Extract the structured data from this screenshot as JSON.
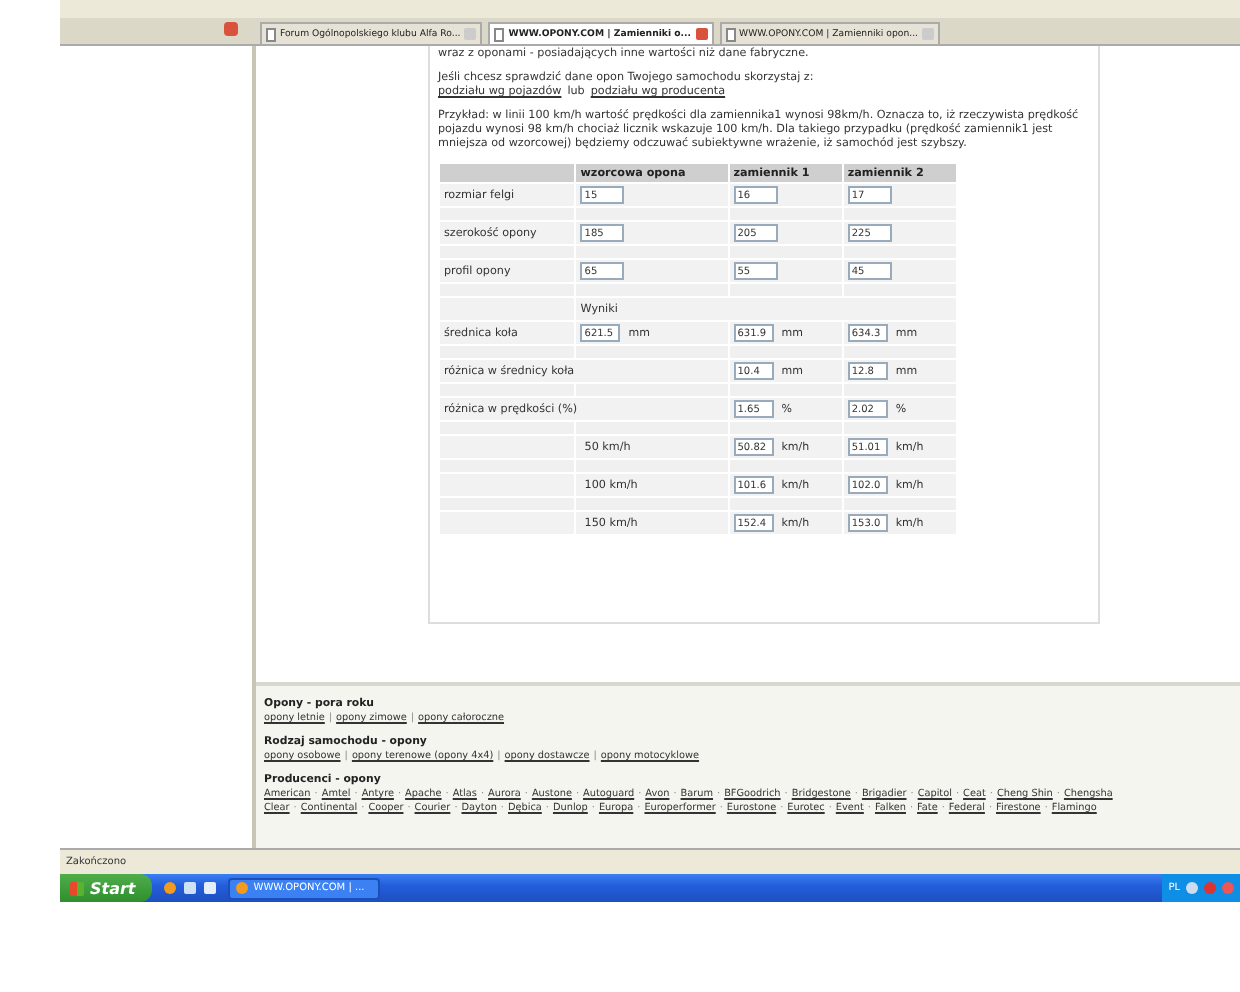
{
  "tabs": [
    {
      "label": "Forum Ogólnopolskiego klubu Alfa Ro...",
      "selected": false
    },
    {
      "label": "WWW.OPONY.COM | Zamienniki o...",
      "selected": true
    },
    {
      "label": "WWW.OPONY.COM | Zamienniki opon...",
      "selected": false
    }
  ],
  "intro": {
    "text": "wraz z oponami - posiadających inne wartości niż dane fabryczne.",
    "lookup_text": "Jeśli chcesz sprawdzić dane opon Twojego samochodu skorzystaj z:",
    "lookup_links": [
      {
        "label": "podziału wg pojazdów"
      },
      {
        "label": "podziału wg producenta"
      }
    ],
    "lookup_separator": "lub",
    "example": "Przykład: w linii 100 km/h wartość prędkości dla zamiennika1 wynosi 98km/h. Oznacza to, iż rzeczywista prędkość pojazdu wynosi 98 km/h chociaż licznik wskazuje 100 km/h. Dla takiego przypadku (prędkość zamiennik1 jest mniejsza od wzorcowej) będziemy odczuwać subiektywne wrażenie, iż samochód jest szybszy."
  },
  "table": {
    "columns": [
      "wzorcowa opona",
      "zamiennik 1",
      "zamiennik 2"
    ],
    "rows": [
      {
        "kind": "input",
        "label": "rozmiar felgi",
        "cells": [
          {
            "value": "15"
          },
          {
            "value": "16"
          },
          {
            "value": "17"
          }
        ]
      },
      {
        "kind": "input",
        "label": "szerokość opony",
        "cells": [
          {
            "value": "185"
          },
          {
            "value": "205"
          },
          {
            "value": "225"
          }
        ]
      },
      {
        "kind": "input",
        "label": "profil opony",
        "cells": [
          {
            "value": "65"
          },
          {
            "value": "55"
          },
          {
            "value": "45"
          }
        ]
      },
      {
        "kind": "section",
        "label": "Wyniki"
      },
      {
        "kind": "input",
        "label": "średnica koła",
        "cells": [
          {
            "value": "621.5",
            "unit": "mm"
          },
          {
            "value": "631.9",
            "unit": "mm"
          },
          {
            "value": "634.3",
            "unit": "mm"
          }
        ]
      },
      {
        "kind": "diff",
        "label": "różnica w średnicy koła",
        "cells": [
          {
            "value": "10.4",
            "unit": "mm"
          },
          {
            "value": "12.8",
            "unit": "mm"
          }
        ]
      },
      {
        "kind": "diff",
        "label": "różnica w prędkości (%)",
        "cells": [
          {
            "value": "1.65",
            "unit": "%"
          },
          {
            "value": "2.02",
            "unit": "%"
          }
        ]
      },
      {
        "kind": "speed",
        "label": "50 km/h",
        "cells": [
          {
            "value": "50.82",
            "unit": "km/h"
          },
          {
            "value": "51.01",
            "unit": "km/h"
          }
        ]
      },
      {
        "kind": "speed",
        "label": "100 km/h",
        "cells": [
          {
            "value": "101.6",
            "unit": "km/h"
          },
          {
            "value": "102.0",
            "unit": "km/h"
          }
        ]
      },
      {
        "kind": "speed",
        "label": "150 km/h",
        "cells": [
          {
            "value": "152.4",
            "unit": "km/h"
          },
          {
            "value": "153.0",
            "unit": "km/h"
          }
        ]
      }
    ]
  },
  "footer": [
    {
      "title": "Opony - pora roku",
      "separator": "|",
      "links": [
        "opony letnie",
        "opony zimowe",
        "opony całoroczne"
      ]
    },
    {
      "title": "Rodzaj samochodu - opony",
      "separator": "|",
      "links": [
        "opony osobowe",
        "opony terenowe (opony 4x4)",
        "opony dostawcze",
        "opony motocyklowe"
      ]
    },
    {
      "title": "Producenci - opony",
      "separator": "·",
      "lines": [
        [
          "American",
          "Amtel",
          "Antyre",
          "Apache",
          "Atlas",
          "Aurora",
          "Austone",
          "Autoguard",
          "Avon",
          "Barum",
          "BFGoodrich",
          "Bridgestone",
          "Brigadier",
          "Capitol",
          "Ceat",
          "Cheng Shin",
          "Chengsha"
        ],
        [
          "Clear",
          "Continental",
          "Cooper",
          "Courier",
          "Dayton",
          "Dębica",
          "Dunlop",
          "Europa",
          "Europerformer",
          "Eurostone",
          "Eurotec",
          "Event",
          "Falken",
          "Fate",
          "Federal",
          "Firestone",
          "Flamingo"
        ]
      ]
    }
  ],
  "status_bar": {
    "text": "Zakończono"
  },
  "taskbar": {
    "start": "Start",
    "window": "WWW.OPONY.COM | ...",
    "language": "PL"
  }
}
